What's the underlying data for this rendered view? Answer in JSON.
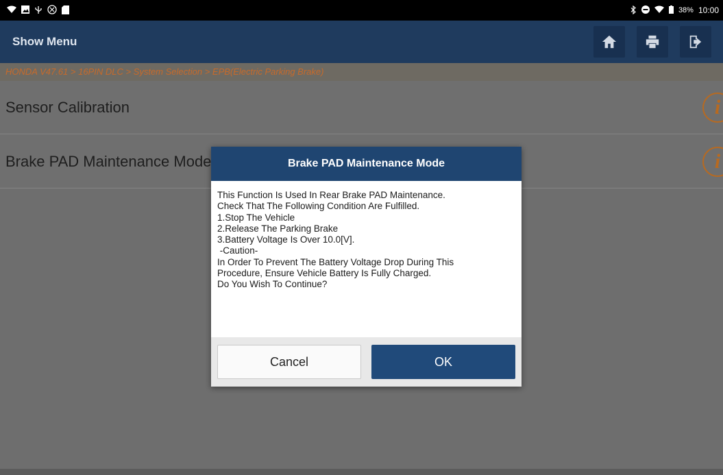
{
  "status_bar": {
    "left_icons": [
      "wifi-question-icon",
      "image-icon",
      "usb-icon",
      "settings-icon",
      "sd-card-icon"
    ],
    "battery": "38%",
    "time": "10:00"
  },
  "header": {
    "title": "Show Menu"
  },
  "breadcrumb": "HONDA V47.61 > 16PIN DLC > System Selection > EPB(Electric Parking Brake)",
  "menu_rows": [
    {
      "label": "Sensor Calibration"
    },
    {
      "label": "Brake PAD Maintenance Mode"
    }
  ],
  "dialog": {
    "title": "Brake PAD Maintenance Mode",
    "lines": [
      "This Function Is Used In Rear Brake PAD Maintenance.",
      "Check That The Following Condition Are Fulfilled.",
      "1.Stop The Vehicle",
      "2.Release The Parking Brake",
      "3.Battery Voltage Is Over 10.0[V].",
      " -Caution-",
      "In Order To Prevent The Battery Voltage Drop During This",
      "Procedure, Ensure Vehicle Battery Is Fully Charged.",
      "Do You Wish To Continue?"
    ],
    "cancel_label": "Cancel",
    "ok_label": "OK"
  },
  "colors": {
    "header_bg": "#1f3b5e",
    "dialog_title_bg": "#1f4571",
    "ok_button_bg": "#204a7a",
    "breadcrumb_text": "#c86a2a",
    "info_icon": "#b86a20"
  }
}
